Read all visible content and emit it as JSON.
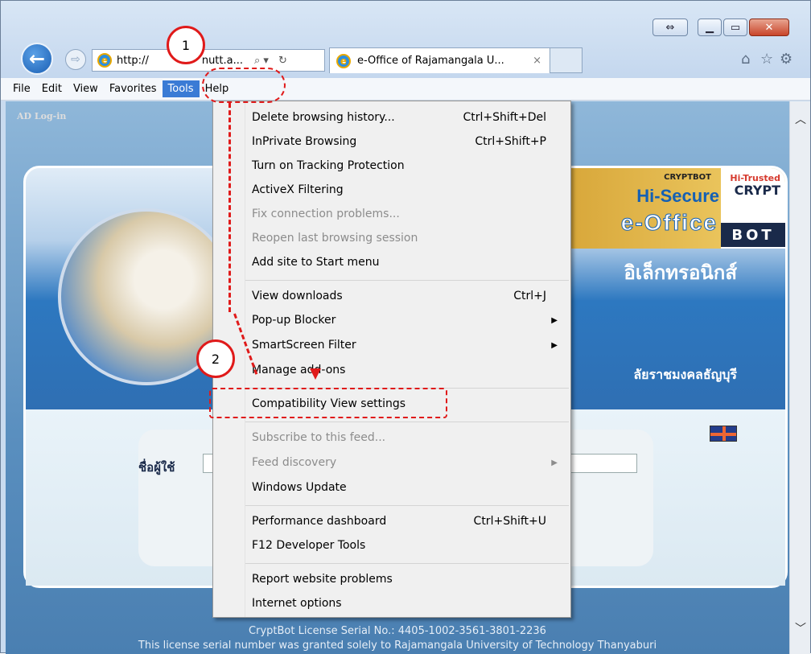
{
  "browser": {
    "address_text": "http://",
    "address_suffix": "nutt.a...",
    "tab_title": "e-Office of Rajamangala U...",
    "tab_close": "×",
    "toolbar_icons": [
      "home-icon",
      "favorites-star-icon",
      "settings-gear-icon"
    ]
  },
  "menubar": {
    "items": [
      "File",
      "Edit",
      "View",
      "Favorites",
      "Tools",
      "Help"
    ],
    "active": "Tools"
  },
  "page": {
    "ad_login": "AD Log-in",
    "logo": {
      "cryptbot_small": "CRYPTBOT",
      "hi_secure": "Hi-Secure",
      "e_office": "e-Office",
      "hi_trusted": "Hi-Trusted",
      "crypt": "CRYPT",
      "bot": "BOT"
    },
    "thai_heading": "อิเล็กทรอนิกส์",
    "thai_sub": "ลัยราชมงคลธัญบุรี",
    "username_label": "ชื่อผู้ใช้",
    "footer_line1": "CryptBot License Serial No.: 4405-1002-3561-3801-2236",
    "footer_line2": "This license serial number was granted solely to Rajamangala University of Technology Thanyaburi"
  },
  "tools_menu": {
    "items": [
      {
        "label": "Delete browsing history...",
        "shortcut": "Ctrl+Shift+Del",
        "disabled": false
      },
      {
        "label": "InPrivate Browsing",
        "shortcut": "Ctrl+Shift+P",
        "disabled": false
      },
      {
        "label": "Turn on Tracking Protection",
        "shortcut": "",
        "disabled": false
      },
      {
        "label": "ActiveX Filtering",
        "shortcut": "",
        "disabled": false
      },
      {
        "label": "Fix connection problems...",
        "shortcut": "",
        "disabled": true
      },
      {
        "label": "Reopen last browsing session",
        "shortcut": "",
        "disabled": true
      },
      {
        "label": "Add site to Start menu",
        "shortcut": "",
        "disabled": false
      },
      {
        "label": "View downloads",
        "shortcut": "Ctrl+J",
        "disabled": false
      },
      {
        "label": "Pop-up Blocker",
        "shortcut": "",
        "submenu": true,
        "disabled": false
      },
      {
        "label": "SmartScreen Filter",
        "shortcut": "",
        "submenu": true,
        "disabled": false
      },
      {
        "label": "Manage add-ons",
        "shortcut": "",
        "disabled": false
      },
      {
        "label": "Compatibility View settings",
        "shortcut": "",
        "disabled": false
      },
      {
        "label": "Subscribe to this feed...",
        "shortcut": "",
        "disabled": true
      },
      {
        "label": "Feed discovery",
        "shortcut": "",
        "submenu": true,
        "disabled": true
      },
      {
        "label": "Windows Update",
        "shortcut": "",
        "disabled": false
      },
      {
        "label": "Performance dashboard",
        "shortcut": "Ctrl+Shift+U",
        "disabled": false
      },
      {
        "label": "F12 Developer Tools",
        "shortcut": "",
        "disabled": false
      },
      {
        "label": "Report website problems",
        "shortcut": "",
        "disabled": false
      },
      {
        "label": "Internet options",
        "shortcut": "",
        "disabled": false
      }
    ]
  },
  "annotations": {
    "callout_1": "1",
    "callout_2": "2",
    "color": "#e01a1a"
  }
}
